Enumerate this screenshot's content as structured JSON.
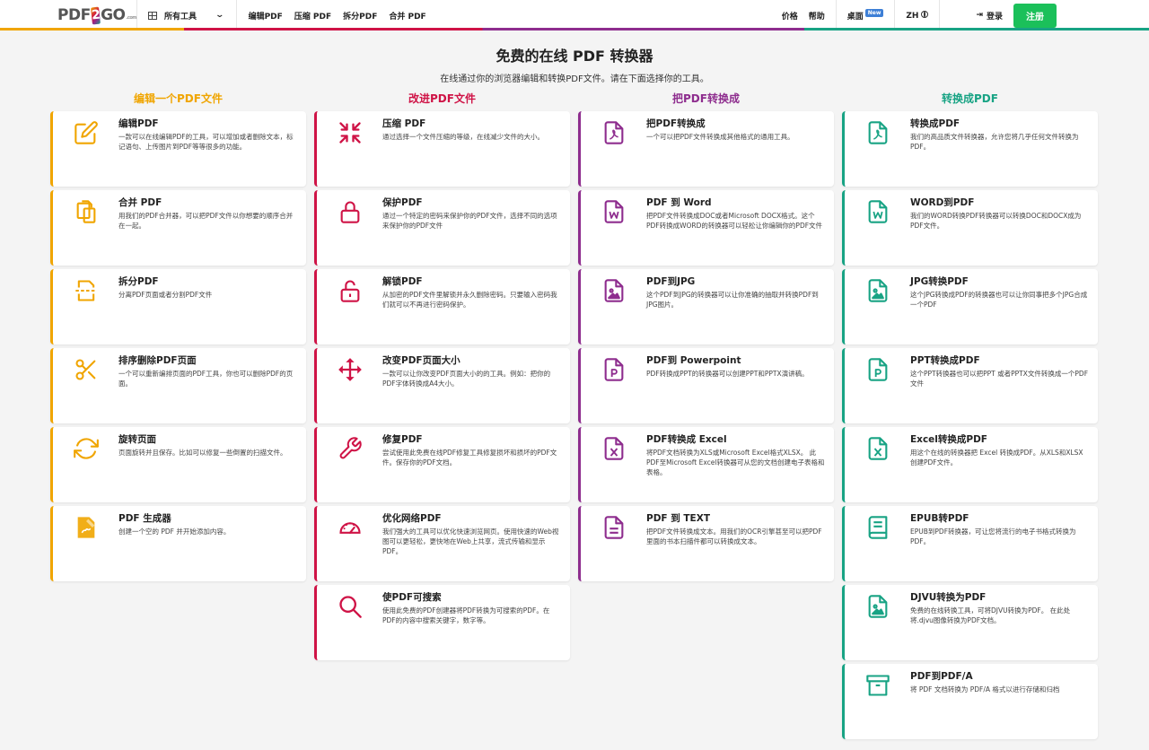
{
  "nav": {
    "logo_a": "PDF",
    "logo_b": "2",
    "logo_c": "GO",
    "logo_d": ".com",
    "all_tools": "所有工具",
    "links": [
      "编辑PDF",
      "压缩 PDF",
      "拆分PDF",
      "合并 PDF"
    ],
    "pricing": "价格",
    "help": "帮助",
    "desktop": "桌面",
    "new_badge": "New",
    "lang": "ZH",
    "login": "登录",
    "register": "注册"
  },
  "hero": {
    "title": "免费的在线 PDF 转换器",
    "subtitle": "在线通过你的浏览器编辑和转换PDF文件。请在下面选择你的工具。"
  },
  "colors": {
    "edit": "#f0a500",
    "improve": "#cf1346",
    "from_pdf": "#8e2d8e",
    "to_pdf": "#18a384",
    "register": "#1bc05a"
  },
  "columns": [
    {
      "title": "编辑一个PDF文件",
      "cards": [
        {
          "title": "编辑PDF",
          "desc": "一款可以在线编辑PDF的工具，可以增加或者删除文本，标记语句、上传图片到PDF等等很多的功能。",
          "icon": "edit-icon"
        },
        {
          "title": "合并 PDF",
          "desc": "用我们的PDF合并器，可以把PDF文件以你想要的顺序合并在一起。",
          "icon": "merge-icon"
        },
        {
          "title": "拆分PDF",
          "desc": "分离PDF页面或者分割PDF文件",
          "icon": "split-icon"
        },
        {
          "title": "排序删除PDF页面",
          "desc": "一个可以重新编排页面的PDF工具，你也可以删除PDF的页面。",
          "icon": "scissors-icon"
        },
        {
          "title": "旋转页面",
          "desc": "页面旋转并且保存。比如可以修复一些倒置的扫描文件。",
          "icon": "rotate-icon"
        },
        {
          "title": "PDF 生成器",
          "desc": "创建一个空的 PDF 并开始添加内容。",
          "icon": "pdf-creator-icon"
        }
      ]
    },
    {
      "title": "改进PDF文件",
      "cards": [
        {
          "title": "压缩 PDF",
          "desc": "通过选择一个文件压缩的等级，在线减少文件的大小。",
          "icon": "compress-icon"
        },
        {
          "title": "保护PDF",
          "desc": "通过一个特定的密码来保护你的PDF文件，选择不同的选项来保护你的PDF文件",
          "icon": "lock-icon"
        },
        {
          "title": "解锁PDF",
          "desc": "从加密的PDF文件里解锁并永久删除密码。只要输入密码我们就可以不再进行密码保护。",
          "icon": "unlock-icon"
        },
        {
          "title": "改变PDF页面大小",
          "desc": "一款可以让你改变PDF页面大小的的工具。例如：把你的PDF字体转换成A4大小。",
          "icon": "resize-icon"
        },
        {
          "title": "修复PDF",
          "desc": "尝试使用此免费在线PDF修复工具修复损坏和损坏的PDF文件。保存你的PDF文档。",
          "icon": "wrench-icon"
        },
        {
          "title": "优化网络PDF",
          "desc": "我们强大的工具可以优化快速浏览网页。使用快速的Web视图可以更轻松，更快地在Web上共享，流式传输和显示PDF。",
          "icon": "speedometer-icon"
        },
        {
          "title": "使PDF可搜索",
          "desc": "使用此免费的PDF创建器将PDF转换为可搜索的PDF。在PDF的内容中搜索关键字，数字等。",
          "icon": "search-icon"
        }
      ]
    },
    {
      "title": "把PDF转换成",
      "cards": [
        {
          "title": "把PDF转换成",
          "desc": "一个可以把PDF文件转换成其他格式的通用工具。",
          "icon": "pdf-file-icon"
        },
        {
          "title": "PDF 到 Word",
          "desc": "把PDF文件转换成DOC或者Microsoft DOCX格式。这个PDF转换成WORD的转换器可以轻松让你编辑你的PDF文件",
          "icon": "word-file-icon"
        },
        {
          "title": "PDF到JPG",
          "desc": "这个PDF到JPG的转换器可以让你准确的抽取并转换PDF到JPG图片。",
          "icon": "image-file-icon"
        },
        {
          "title": "PDF到 Powerpoint",
          "desc": "PDF转换成PPT的转换器可以创建PPT和PPTX演讲稿。",
          "icon": "ppt-file-icon"
        },
        {
          "title": "PDF转换成 Excel",
          "desc": "将PDF文档转换为XLS或Microsoft Excel格式XLSX。 此PDF至Microsoft Excel转换器可从您的文档创建电子表格和表格。",
          "icon": "excel-file-icon"
        },
        {
          "title": "PDF 到 TEXT",
          "desc": "把PDF文件转换成文本。用我们的OCR引擎甚至可以把PDF里面的书本扫描件都可以转换成文本。",
          "icon": "text-file-icon"
        }
      ]
    },
    {
      "title": "转换成PDF",
      "cards": [
        {
          "title": "转换成PDF",
          "desc": "我们的高品质文件转换器，允许您将几乎任何文件转换为PDF。",
          "icon": "pdf-file-icon"
        },
        {
          "title": "WORD到PDF",
          "desc": "我们的WORD转换PDF转换器可以转换DOC和DOCX成为PDF文件。",
          "icon": "word-file-icon"
        },
        {
          "title": "JPG转换PDF",
          "desc": "这个JPG转换成PDF的转换器也可以让你同事把多个JPG合成一个PDF",
          "icon": "image-file-icon"
        },
        {
          "title": "PPT转换成PDF",
          "desc": "这个PPT转换器也可以把PPT 或者PPTX文件转换成一个PDF文件",
          "icon": "ppt-file-icon"
        },
        {
          "title": "Excel转换成PDF",
          "desc": "用这个在线的转换器把 Excel 转换成PDF。从XLS和XLSX创建PDF文件。",
          "icon": "excel-file-icon"
        },
        {
          "title": "EPUB转PDF",
          "desc": "EPUB到PDF转换器，可让您将流行的电子书格式转换为PDF。",
          "icon": "book-icon"
        },
        {
          "title": "DJVU转换为PDF",
          "desc": "免费的在线转换工具，可将DJVU转换为PDF。 在此处将.djvu图像转换为PDF文档。",
          "icon": "image-file-icon"
        },
        {
          "title": "PDF到PDF/A",
          "desc": "将 PDF 文档转换为 PDF/A 格式以进行存储和归档",
          "icon": "archive-icon"
        }
      ]
    }
  ]
}
